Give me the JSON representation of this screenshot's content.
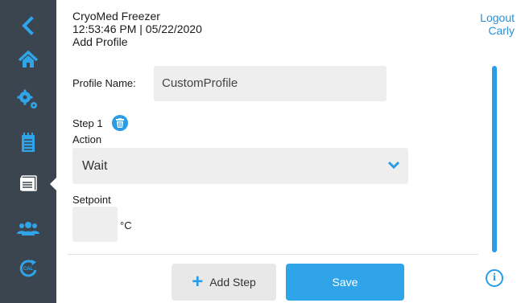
{
  "header": {
    "app_title": "CryoMed Freezer",
    "datetime": "12:53:46 PM | 05/22/2020",
    "page_title": "Add Profile"
  },
  "user": {
    "logout_label": "Logout",
    "username": "Carly"
  },
  "sidebar": {
    "items": [
      {
        "icon": "back-icon"
      },
      {
        "icon": "home-icon"
      },
      {
        "icon": "gears-icon"
      },
      {
        "icon": "notepad-icon"
      },
      {
        "icon": "calendar-icon",
        "active": true
      },
      {
        "icon": "users-icon"
      },
      {
        "icon": "calibration-icon"
      }
    ]
  },
  "form": {
    "profile_name_label": "Profile Name:",
    "profile_name_value": "CustomProfile",
    "step_label": "Step 1",
    "action_label": "Action",
    "action_value": "Wait",
    "setpoint_label": "Setpoint",
    "setpoint_value": "",
    "setpoint_unit": "°C"
  },
  "buttons": {
    "add_step": "Add Step",
    "save": "Save"
  },
  "colors": {
    "sidebar_bg": "#3b4550",
    "accent": "#2a9be6",
    "field_bg": "#eeeeee"
  }
}
